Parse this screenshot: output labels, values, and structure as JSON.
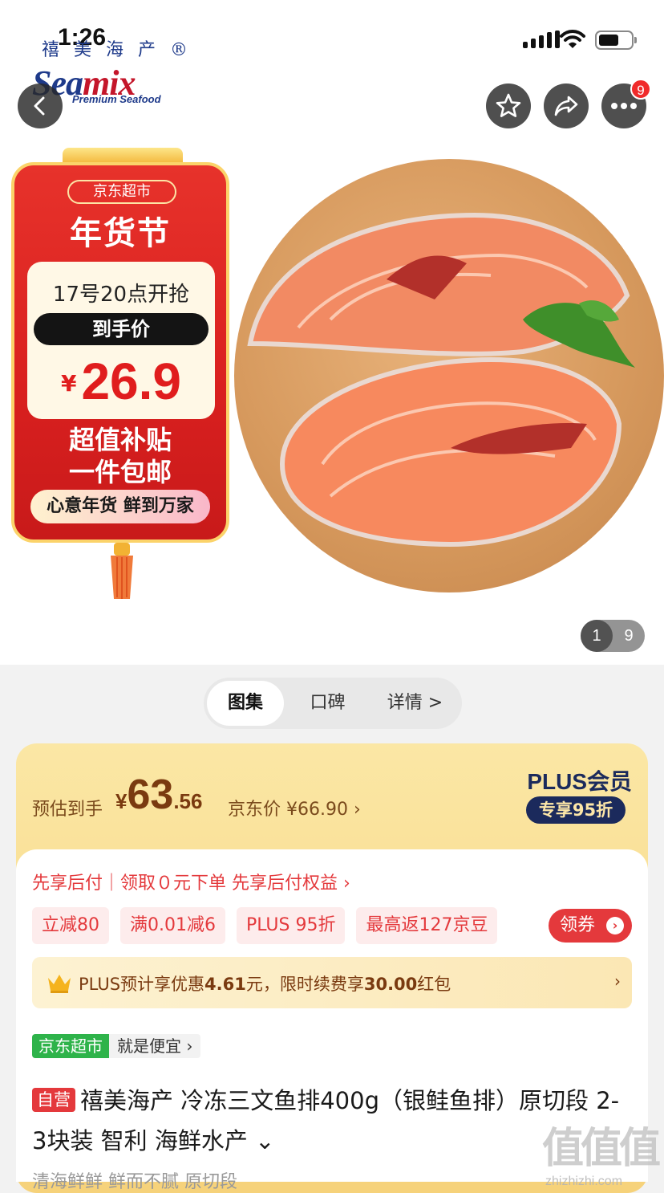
{
  "status_bar": {
    "time": "1:26"
  },
  "brand": {
    "cn": "禧美海产®",
    "en_1": "Sea",
    "en_2": "mix",
    "tagline": "Premium Seafood"
  },
  "nav": {
    "more_badge": "9"
  },
  "promo_banner": {
    "tag": "京东超市",
    "headline": "年货节",
    "time": "17号20点开抢",
    "pill": "到手价",
    "currency": "¥",
    "price": "26.9",
    "slogan_1": "超值补贴",
    "slogan_2": "一件包邮",
    "footer": "心意年货 鲜到万家"
  },
  "gallery_pager": {
    "current": "1",
    "total": "9"
  },
  "segments": [
    {
      "label": "图集"
    },
    {
      "label": "口碑"
    },
    {
      "label": "详情 >"
    }
  ],
  "price": {
    "est_label": "预估到手",
    "currency": "¥",
    "int": "63",
    "dec": ".56",
    "jd_price": "京东价 ¥66.90 ›",
    "plus_logo": "PLUS会员",
    "plus_pill": "专享95折"
  },
  "promo": {
    "paylater": "先享后付｜领取０元下单 先享后付权益 ›",
    "chips": [
      "立减80",
      "满0.01减6",
      "PLUS 95折",
      "最高返127京豆"
    ],
    "coupon_button": "领券",
    "plus_bar_1": "PLUS预计享优惠",
    "plus_bar_2": "4.61",
    "plus_bar_3": "元，限时续费享",
    "plus_bar_4": "30.00",
    "plus_bar_5": "红包"
  },
  "store": {
    "name": "京东超市",
    "slogan": "就是便宜 ›"
  },
  "product": {
    "self_tag": "自营",
    "title": "禧美海产 冷冻三文鱼排400g（银鲑鱼排）原切段 2-3块装 智利 海鲜水产 ⌄",
    "subtitle": "清海鲜鲜 鲜而不腻 原切段"
  },
  "watermark": {
    "text": "值值值",
    "url": "zhizhizhi.com"
  },
  "colors": {
    "accent": "#e4393c",
    "gold": "#f6d27a",
    "navy": "#1b2a5c",
    "jd_green": "#2eb34a"
  }
}
